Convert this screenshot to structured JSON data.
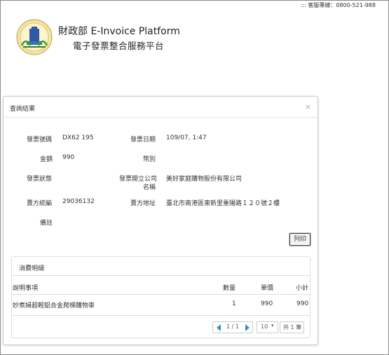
{
  "header": {
    "hotline": "::: 客服專線：0800-521-988",
    "title_zh": "財政部",
    "title_en": "E-Invoice Platform",
    "subtitle": "電子發票整合服務平台"
  },
  "modal": {
    "title": "查詢結果",
    "close": "×",
    "fields": {
      "invoice_no_label": "發票號碼",
      "invoice_no_value": "DX62      195",
      "invoice_date_label": "發票日期",
      "invoice_date_value": "109/07,          1:47",
      "amount_label": "金額",
      "amount_value": "990",
      "currency_label": "幣別",
      "currency_value": "",
      "status_label": "發票狀態",
      "status_value": "",
      "issuer_label_1": "發票開立公司",
      "issuer_label_2": "名稱",
      "issuer_value": "美好家庭購物股份有限公司",
      "seller_id_label": "賣方統編",
      "seller_id_value": "29036132",
      "seller_addr_label": "賣方地址",
      "seller_addr_value": "臺北市南港區東新里重陽路１２０號２樓",
      "remark_label": "備註",
      "remark_value": ""
    },
    "print_button": "列印"
  },
  "details": {
    "title": "消費明細",
    "columns": [
      "說明事項",
      "數量",
      "單價",
      "小計"
    ],
    "rows": [
      {
        "desc": "妙煮婦超輕鋁合金爬梯購物車",
        "qty": "1",
        "price": "990",
        "subtotal": "990"
      }
    ],
    "pager": {
      "page": "1 / 1",
      "page_size": "10",
      "total": "共 1 筆"
    }
  },
  "colors": {
    "pager_arrow": "#3a8dc5",
    "border": "#dddddd"
  }
}
